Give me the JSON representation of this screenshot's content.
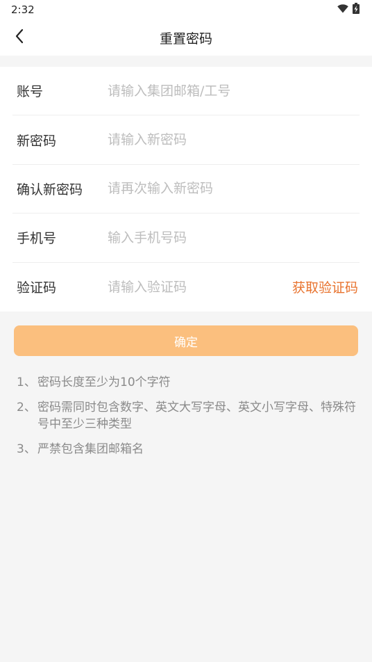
{
  "status_bar": {
    "time": "2:32",
    "icons": [
      "wifi-icon",
      "battery-charging-icon"
    ]
  },
  "header": {
    "title": "重置密码",
    "back_icon": "chevron-left-icon"
  },
  "form": {
    "account": {
      "label": "账号",
      "value": "",
      "placeholder": "请输入集团邮箱/工号"
    },
    "new_password": {
      "label": "新密码",
      "value": "",
      "placeholder": "请输入新密码"
    },
    "confirm_password": {
      "label": "确认新密码",
      "value": "",
      "placeholder": "请再次输入新密码"
    },
    "phone": {
      "label": "手机号",
      "value": "",
      "placeholder": "输入手机号码"
    },
    "code": {
      "label": "验证码",
      "value": "",
      "placeholder": "请输入验证码",
      "action": "获取验证码"
    }
  },
  "confirm_label": "确定",
  "rules": [
    {
      "num": "1、",
      "text": "密码长度至少为10个字符"
    },
    {
      "num": "2、",
      "text": "密码需同时包含数字、英文大写字母、英文小写字母、特殊符号中至少三种类型"
    },
    {
      "num": "3、",
      "text": "严禁包含集团邮箱名"
    }
  ],
  "colors": {
    "accent": "#e8732e",
    "button_bg": "#fbbf7e",
    "background": "#f5f5f5",
    "placeholder": "#bdbdbd",
    "hint_text": "#8a8a8a"
  }
}
